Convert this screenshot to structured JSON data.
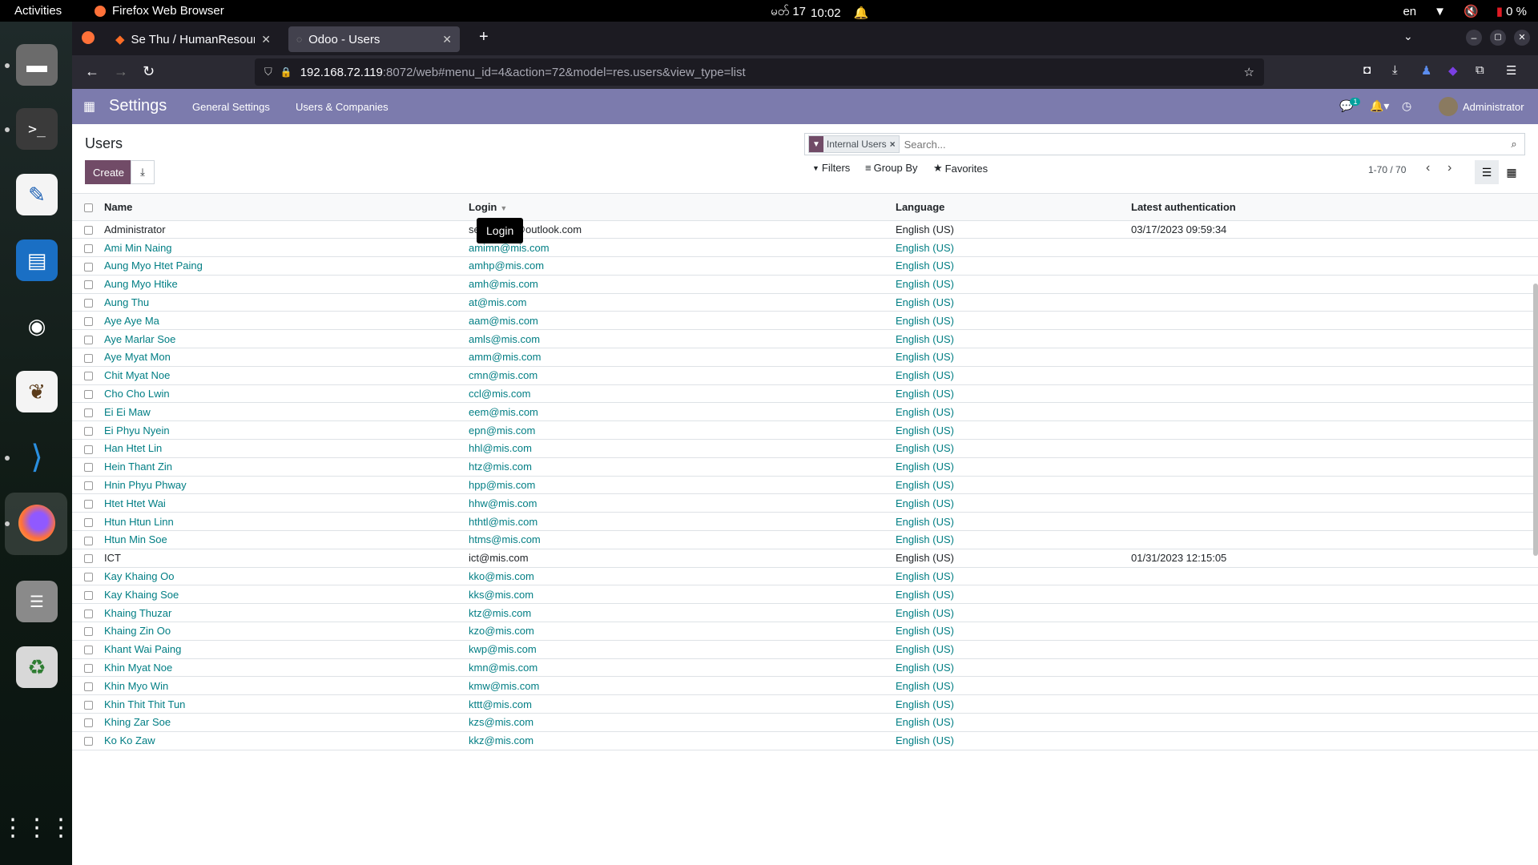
{
  "system_bar": {
    "activities": "Activities",
    "app_name": "Firefox Web Browser",
    "date": "မတ် 17",
    "time": "10:02",
    "lang": "en",
    "battery": "0 %"
  },
  "browser": {
    "tabs": [
      {
        "title": "Se Thu / HumanResource",
        "active": false
      },
      {
        "title": "Odoo - Users",
        "active": true
      }
    ],
    "url_host": "192.168.72.119",
    "url_path": ":8072/web#menu_id=4&action=72&model=res.users&view_type=list"
  },
  "odoo_nav": {
    "app_title": "Settings",
    "menu": [
      "General Settings",
      "Users & Companies"
    ],
    "chat_badge": "1",
    "user": "Administrator"
  },
  "control_panel": {
    "title": "Users",
    "create_label": "Create",
    "facet_label": "Internal Users",
    "search_placeholder": "Search...",
    "filters_label": "Filters",
    "groupby_label": "Group By",
    "favorites_label": "Favorites",
    "pager": "1-70 / 70"
  },
  "table": {
    "headers": {
      "name": "Name",
      "login": "Login",
      "language": "Language",
      "latest_auth": "Latest authentication"
    },
    "rows": [
      {
        "name": "Administrator",
        "login": "sethu.rom@outlook.com",
        "language": "English (US)",
        "auth": "03/17/2023 09:59:34",
        "style": "plain"
      },
      {
        "name": "Ami Min Naing",
        "login": "amimn@mis.com",
        "language": "English (US)",
        "auth": "",
        "style": "link"
      },
      {
        "name": "Aung Myo Htet Paing",
        "login": "amhp@mis.com",
        "language": "English (US)",
        "auth": "",
        "style": "link"
      },
      {
        "name": "Aung Myo Htike",
        "login": "amh@mis.com",
        "language": "English (US)",
        "auth": "",
        "style": "link"
      },
      {
        "name": "Aung Thu",
        "login": "at@mis.com",
        "language": "English (US)",
        "auth": "",
        "style": "link"
      },
      {
        "name": "Aye Aye Ma",
        "login": "aam@mis.com",
        "language": "English (US)",
        "auth": "",
        "style": "link"
      },
      {
        "name": "Aye Marlar Soe",
        "login": "amls@mis.com",
        "language": "English (US)",
        "auth": "",
        "style": "link"
      },
      {
        "name": "Aye Myat Mon",
        "login": "amm@mis.com",
        "language": "English (US)",
        "auth": "",
        "style": "link"
      },
      {
        "name": "Chit Myat Noe",
        "login": "cmn@mis.com",
        "language": "English (US)",
        "auth": "",
        "style": "link"
      },
      {
        "name": "Cho Cho Lwin",
        "login": "ccl@mis.com",
        "language": "English (US)",
        "auth": "",
        "style": "link"
      },
      {
        "name": "Ei Ei Maw",
        "login": "eem@mis.com",
        "language": "English (US)",
        "auth": "",
        "style": "link"
      },
      {
        "name": "Ei Phyu Nyein",
        "login": "epn@mis.com",
        "language": "English (US)",
        "auth": "",
        "style": "link"
      },
      {
        "name": "Han Htet Lin",
        "login": "hhl@mis.com",
        "language": "English (US)",
        "auth": "",
        "style": "link"
      },
      {
        "name": "Hein Thant Zin",
        "login": "htz@mis.com",
        "language": "English (US)",
        "auth": "",
        "style": "link"
      },
      {
        "name": "Hnin Phyu Phway",
        "login": "hpp@mis.com",
        "language": "English (US)",
        "auth": "",
        "style": "link"
      },
      {
        "name": "Htet Htet Wai",
        "login": "hhw@mis.com",
        "language": "English (US)",
        "auth": "",
        "style": "link"
      },
      {
        "name": "Htun Htun Linn",
        "login": "hthtl@mis.com",
        "language": "English (US)",
        "auth": "",
        "style": "link"
      },
      {
        "name": "Htun Min Soe",
        "login": "htms@mis.com",
        "language": "English (US)",
        "auth": "",
        "style": "link"
      },
      {
        "name": "ICT",
        "login": "ict@mis.com",
        "language": "English (US)",
        "auth": "01/31/2023 12:15:05",
        "style": "plain"
      },
      {
        "name": "Kay Khaing Oo",
        "login": "kko@mis.com",
        "language": "English (US)",
        "auth": "",
        "style": "link"
      },
      {
        "name": "Kay Khaing Soe",
        "login": "kks@mis.com",
        "language": "English (US)",
        "auth": "",
        "style": "link"
      },
      {
        "name": "Khaing Thuzar",
        "login": "ktz@mis.com",
        "language": "English (US)",
        "auth": "",
        "style": "link"
      },
      {
        "name": "Khaing Zin Oo",
        "login": "kzo@mis.com",
        "language": "English (US)",
        "auth": "",
        "style": "link"
      },
      {
        "name": "Khant Wai Paing",
        "login": "kwp@mis.com",
        "language": "English (US)",
        "auth": "",
        "style": "link"
      },
      {
        "name": "Khin Myat Noe",
        "login": "kmn@mis.com",
        "language": "English (US)",
        "auth": "",
        "style": "link"
      },
      {
        "name": "Khin Myo Win",
        "login": "kmw@mis.com",
        "language": "English (US)",
        "auth": "",
        "style": "link"
      },
      {
        "name": "Khin Thit Thit Tun",
        "login": "kttt@mis.com",
        "language": "English (US)",
        "auth": "",
        "style": "link"
      },
      {
        "name": "Khing Zar Soe",
        "login": "kzs@mis.com",
        "language": "English (US)",
        "auth": "",
        "style": "link"
      },
      {
        "name": "Ko Ko Zaw",
        "login": "kkz@mis.com",
        "language": "English (US)",
        "auth": "",
        "style": "link"
      }
    ]
  },
  "tooltip": "Login",
  "colors": {
    "odoo_nav": "#7c7bad",
    "primary": "#714b67",
    "link": "#017e84"
  }
}
